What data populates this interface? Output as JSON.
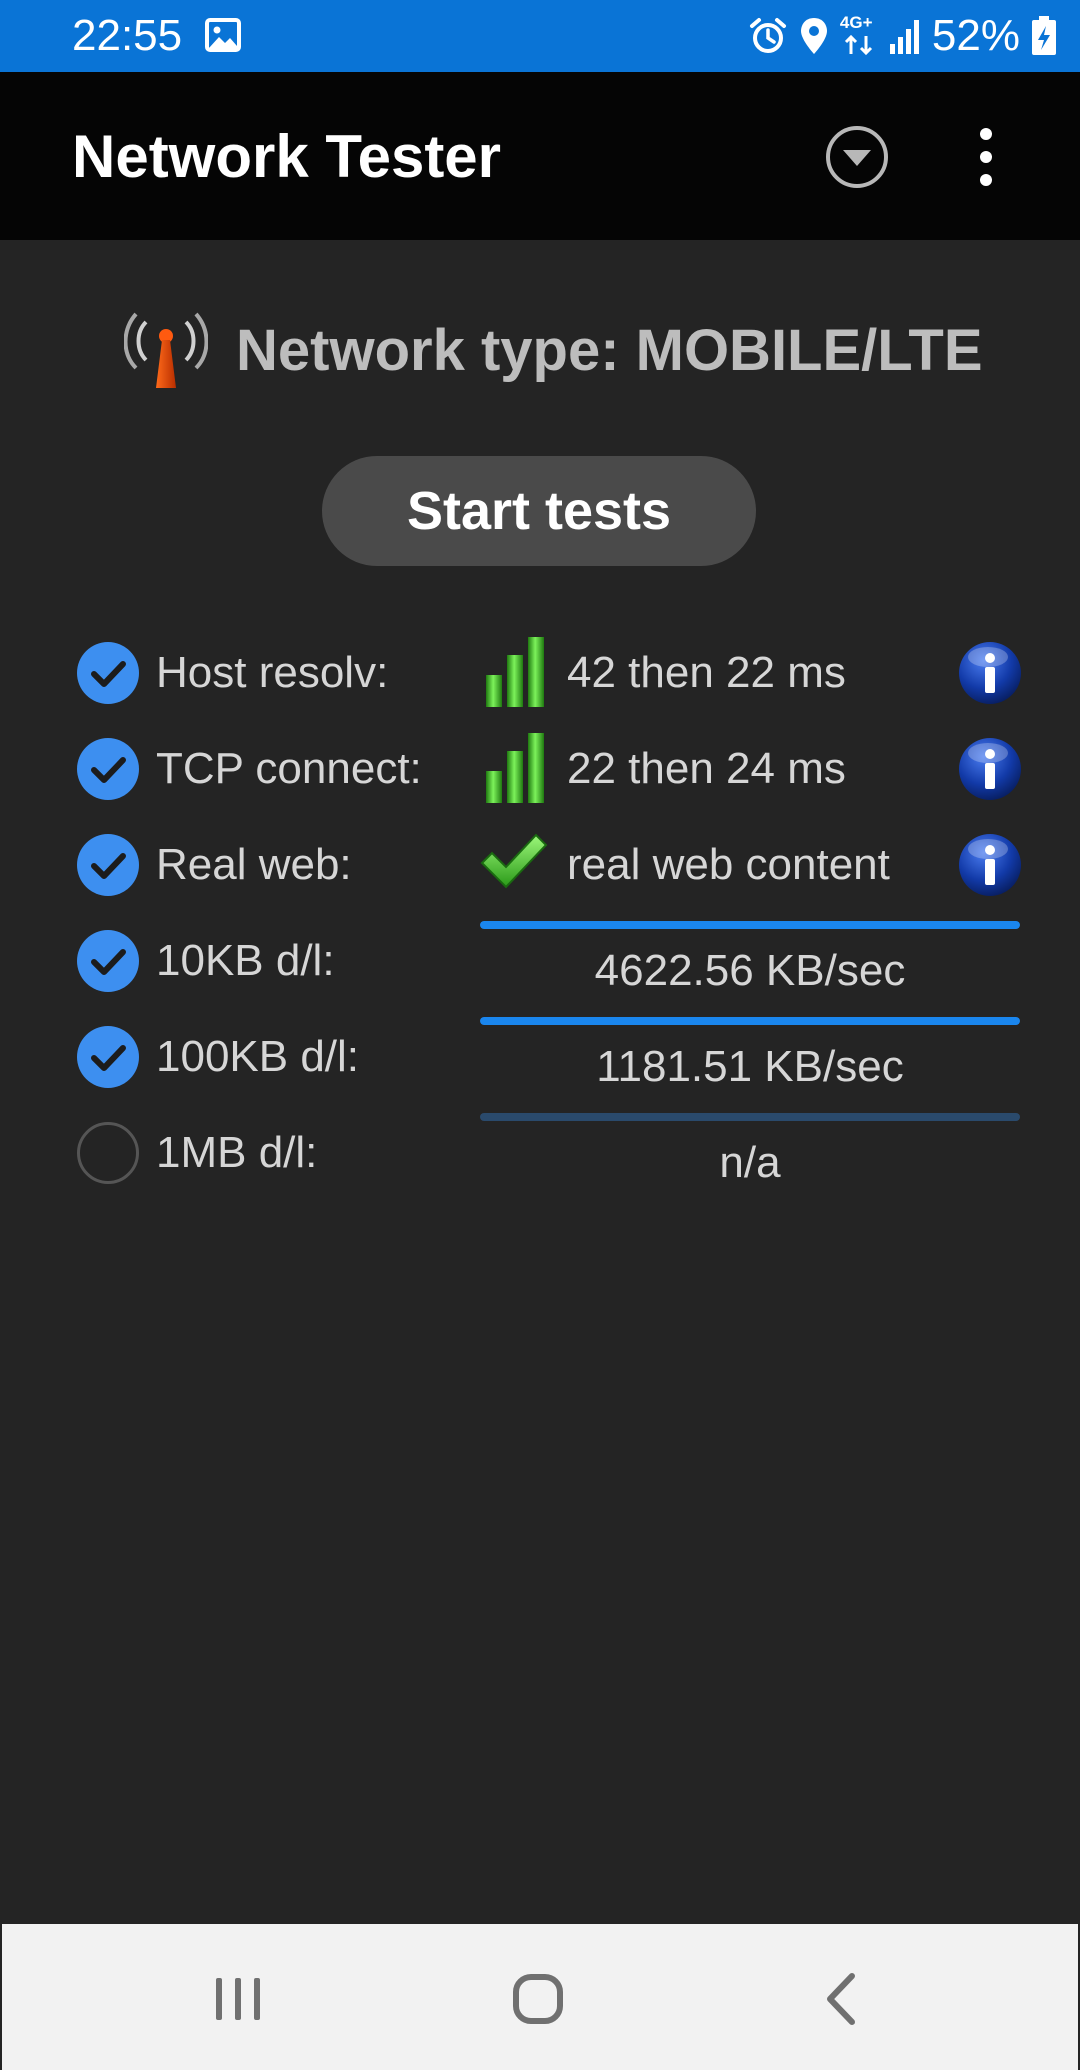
{
  "status_bar": {
    "time": "22:55",
    "icons": [
      "gallery-icon",
      "alarm-icon",
      "location-icon",
      "4g-plus-icon",
      "signal-icon",
      "battery-charging-icon"
    ],
    "network_badge": "4G+",
    "battery_percent": "52%"
  },
  "app_bar": {
    "title": "Network Tester",
    "icons": [
      "dropdown-icon",
      "more-options-icon"
    ]
  },
  "network": {
    "icon": "antenna-icon",
    "text": "Network type: MOBILE/LTE"
  },
  "start_button": {
    "label": "Start tests"
  },
  "tests": [
    {
      "label": "Host resolv:",
      "checked": true,
      "result_icon": "signal-bars-icon",
      "value": "42 then 22 ms",
      "info": true
    },
    {
      "label": "TCP connect:",
      "checked": true,
      "result_icon": "signal-bars-icon",
      "value": "22 then 24 ms",
      "info": true
    },
    {
      "label": "Real web:",
      "checked": true,
      "result_icon": "green-check-icon",
      "value": "real web content",
      "info": true
    }
  ],
  "downloads": [
    {
      "label": "10KB d/l:",
      "checked": true,
      "progress": 1.0,
      "value": "4622.56 KB/sec"
    },
    {
      "label": "100KB d/l:",
      "checked": true,
      "progress": 1.0,
      "value": "1181.51 KB/sec"
    },
    {
      "label": "1MB d/l:",
      "checked": false,
      "progress": 0.0,
      "value": "n/a"
    }
  ],
  "colors": {
    "status_bar": "#0a74d6",
    "app_bar": "#050505",
    "background": "#242424",
    "accent": "#1a86ee",
    "checkbox": "#3d8ff0"
  },
  "nav_bar": {
    "icons": [
      "recents-icon",
      "home-icon",
      "back-icon"
    ]
  }
}
